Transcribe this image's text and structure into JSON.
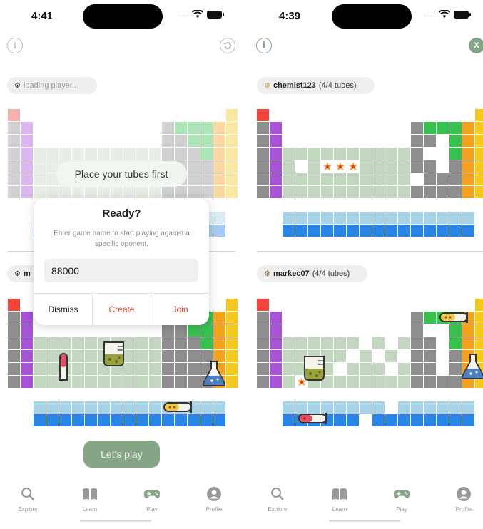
{
  "left_screen": {
    "status": {
      "time": "4:41",
      "signal_dots": "...."
    },
    "info_icon": "info-icon",
    "reset_icon": "reset-icon",
    "opponent_pill": {
      "text": "loading player..."
    },
    "player_pill": {
      "name": "m"
    },
    "toast": {
      "text": "Place your tubes first"
    },
    "dialog": {
      "title": "Ready?",
      "message": "Enter game name to start playing against a specific oponent.",
      "input_value": "88000",
      "dismiss_label": "Dismiss",
      "create_label": "Create",
      "join_label": "Join"
    },
    "play_button": {
      "label": "Let's play"
    }
  },
  "right_screen": {
    "status": {
      "time": "4:39",
      "signal_dots": "...."
    },
    "info_icon": "info-icon",
    "close_icon": "close-icon",
    "close_label": "X",
    "opponent_pill": {
      "name": "chemist123",
      "tubes": "(4/4 tubes)"
    },
    "player_pill": {
      "name": "markec07",
      "tubes": "(4/4 tubes)"
    }
  },
  "tabbar": {
    "items": [
      {
        "label": "Explore",
        "icon": "search-icon"
      },
      {
        "label": "Learn",
        "icon": "book-icon"
      },
      {
        "label": "Play",
        "icon": "gamepad-icon"
      },
      {
        "label": "Profile",
        "icon": "person-icon"
      }
    ]
  },
  "colors": {
    "accent": "#86a486",
    "red_action": "#e0473a",
    "hidden_cell": "#c3d7c0",
    "alkali": "#f0443c",
    "alkaline": "#a653d6",
    "metal": "#8e8e8e",
    "nonmetal": "#37c24f",
    "noble": "#f4c81d",
    "halogen": "#f2a21e",
    "lanthanide": "#a7d3e6",
    "actinide": "#2b85e6",
    "hit": "#ff9a33"
  }
}
